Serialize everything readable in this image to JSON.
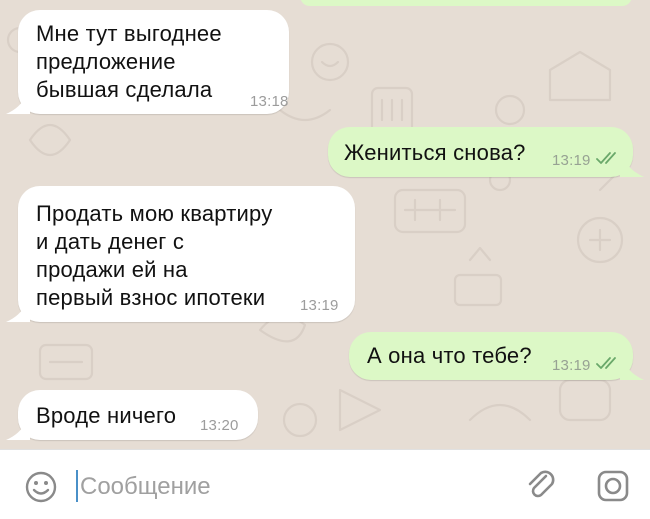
{
  "messages": [
    {
      "direction": "in",
      "text": "Мне тут выгоднее\nпредложение\nбывшая сделала",
      "time": "13:18"
    },
    {
      "direction": "out",
      "text": "Жениться снова?",
      "time": "13:19",
      "status": "read"
    },
    {
      "direction": "in",
      "text": "Продать мою квартиру\nи дать денег с\nпродажи ей на\nпервый взнос ипотеки",
      "time": "13:19"
    },
    {
      "direction": "out",
      "text": "А она что тебе?",
      "time": "13:19",
      "status": "read"
    },
    {
      "direction": "in",
      "text": "Вроде ничего",
      "time": "13:20"
    }
  ],
  "composer": {
    "placeholder": "Сообщение",
    "emoji_icon": "emoji-icon",
    "attach_icon": "paperclip-icon",
    "camera_icon": "camera-icon"
  },
  "colors": {
    "incoming_bubble": "#ffffff",
    "outgoing_bubble": "#dcf8c6",
    "wallpaper": "#e6ddd4",
    "read_ticks": "#6aa86a"
  }
}
